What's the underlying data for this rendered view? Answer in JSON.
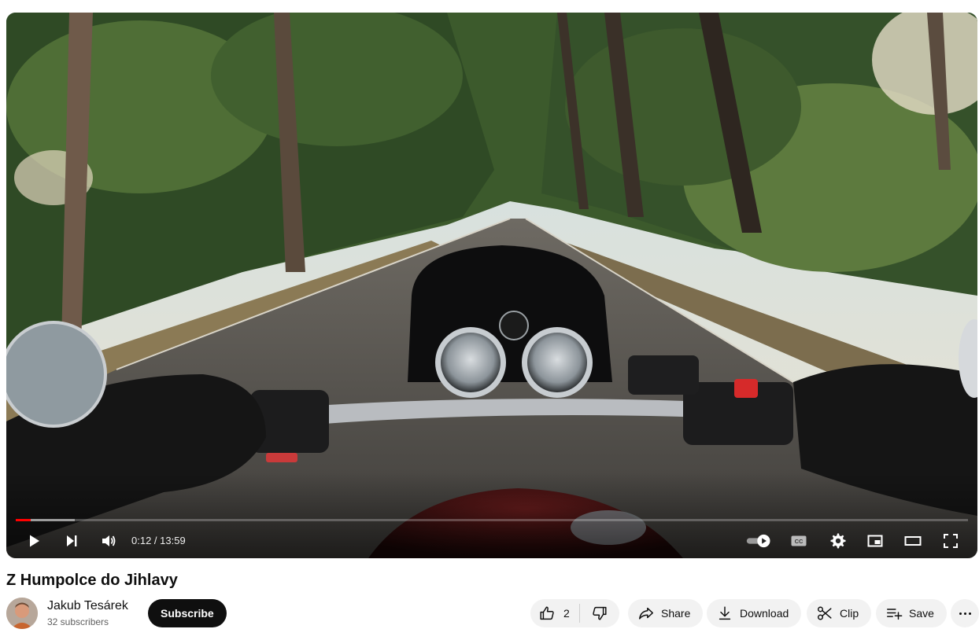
{
  "video": {
    "title": "Z Humpolce do Jihlavy",
    "current_time": "0:12",
    "duration": "13:59",
    "time_display": "0:12 / 13:59",
    "progress_played_fraction": 0.016,
    "progress_loaded_fraction": 0.062
  },
  "channel": {
    "name": "Jakub Tesárek",
    "subscribers": "32 subscribers",
    "subscribe_label": "Subscribe"
  },
  "actions": {
    "like_count": "2",
    "share_label": "Share",
    "download_label": "Download",
    "clip_label": "Clip",
    "save_label": "Save"
  },
  "icons": {
    "play": "play-icon",
    "next": "next-icon",
    "volume": "volume-icon",
    "autoplay": "autoplay-toggle-icon",
    "captions": "captions-icon",
    "settings": "gear-icon",
    "miniplayer": "miniplayer-icon",
    "theater": "theater-mode-icon",
    "fullscreen": "fullscreen-icon"
  },
  "colors": {
    "progress_played": "#ff0000",
    "subscribe_bg": "#0f0f0f",
    "pill_bg": "#f2f2f2"
  }
}
